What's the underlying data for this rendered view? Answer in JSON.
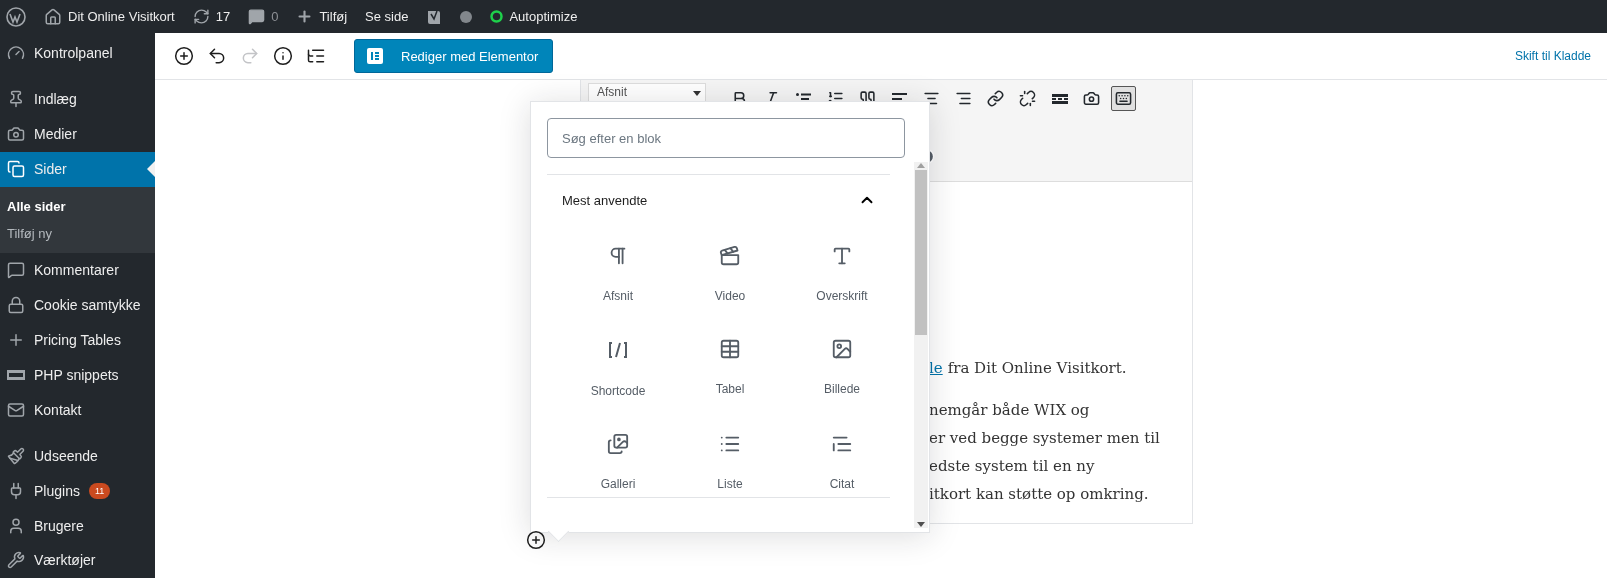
{
  "admin_bar": {
    "items": [
      {
        "kind": "logo"
      },
      {
        "kind": "site",
        "label": "Dit Online Visitkort"
      },
      {
        "kind": "updates",
        "label": "17"
      },
      {
        "kind": "comments",
        "label": "0"
      },
      {
        "kind": "new",
        "label": "Tilføj"
      },
      {
        "kind": "link",
        "label": "Se side"
      },
      {
        "kind": "seo"
      },
      {
        "kind": "status"
      },
      {
        "kind": "optimize",
        "label": "Autoptimize"
      }
    ]
  },
  "sidebar": {
    "items": [
      {
        "kind": "dashboard",
        "label": "Kontrolpanel",
        "selected": false
      },
      {
        "kind": "separator"
      },
      {
        "kind": "posts",
        "label": "Indlæg",
        "selected": false
      },
      {
        "kind": "media",
        "label": "Medier",
        "selected": false
      },
      {
        "kind": "pages",
        "label": "Sider",
        "selected": true,
        "submenu": [
          {
            "label": "Alle sider",
            "selected": true
          },
          {
            "label": "Tilføj ny",
            "selected": false
          }
        ]
      },
      {
        "kind": "comments",
        "label": "Kommentarer",
        "selected": false
      },
      {
        "kind": "lock",
        "label": "Cookie samtykke",
        "selected": false
      },
      {
        "kind": "plus",
        "label": "Pricing Tables",
        "selected": false
      },
      {
        "kind": "php",
        "label": "PHP snippets",
        "selected": false
      },
      {
        "kind": "mail",
        "label": "Kontakt",
        "selected": false
      },
      {
        "kind": "separator"
      },
      {
        "kind": "appearance",
        "label": "Udseende",
        "selected": false
      },
      {
        "kind": "plugins",
        "label": "Plugins",
        "selected": false,
        "badge": "11"
      },
      {
        "kind": "users",
        "label": "Brugere",
        "selected": false
      },
      {
        "kind": "tools",
        "label": "Værktøjer",
        "selected": false
      }
    ]
  },
  "editor_toolbar": {
    "tools": [
      {
        "kind": "add",
        "disabled": false
      },
      {
        "kind": "undo",
        "disabled": false
      },
      {
        "kind": "redo",
        "disabled": true
      },
      {
        "kind": "info",
        "disabled": false
      },
      {
        "kind": "outline",
        "disabled": false
      }
    ],
    "elementor_button": "Rediger med Elementor",
    "switch_to_draft": "Skift til Kladde"
  },
  "classic_block": {
    "format_select": "Afsnit",
    "buttons": [
      {
        "kind": "bold",
        "selected": false
      },
      {
        "kind": "italic",
        "selected": false
      },
      {
        "kind": "bullets",
        "selected": false
      },
      {
        "kind": "numbers",
        "selected": false
      },
      {
        "kind": "quote",
        "selected": false
      },
      {
        "kind": "align-left",
        "selected": false
      },
      {
        "kind": "align-center",
        "selected": false
      },
      {
        "kind": "align-right",
        "selected": false
      },
      {
        "kind": "link",
        "selected": false
      },
      {
        "kind": "unlink",
        "selected": false
      },
      {
        "kind": "more",
        "selected": false
      },
      {
        "kind": "media",
        "selected": false
      },
      {
        "kind": "toolbar-toggle",
        "selected": true
      }
    ],
    "paragraphs": [
      {
        "lines": [
          {
            "link": "le",
            "text": "fra Dit Online Visitkort."
          }
        ]
      },
      {
        "lines": [
          {
            "text": "nemgår både WIX og"
          },
          {
            "text": "er ved begge systemer men til"
          },
          {
            "text": "edste system til en ny"
          },
          {
            "text": "itkort kan støtte op omkring."
          }
        ]
      }
    ]
  },
  "inserter": {
    "placeholder": "Søg efter en blok",
    "section": {
      "title": "Mest anvendte",
      "expanded": true,
      "blocks": [
        {
          "kind": "paragraph",
          "label": "Afsnit"
        },
        {
          "kind": "video",
          "label": "Video"
        },
        {
          "kind": "heading",
          "label": "Overskrift"
        },
        {
          "kind": "shortcode",
          "label": "Shortcode"
        },
        {
          "kind": "table",
          "label": "Tabel"
        },
        {
          "kind": "image",
          "label": "Billede"
        },
        {
          "kind": "gallery",
          "label": "Galleri"
        },
        {
          "kind": "list",
          "label": "Liste"
        },
        {
          "kind": "quote",
          "label": "Citat"
        }
      ]
    }
  }
}
